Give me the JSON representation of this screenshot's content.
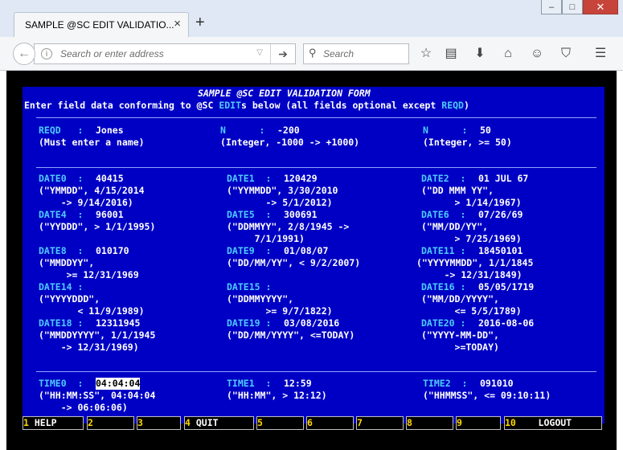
{
  "browser": {
    "tab_title": "SAMPLE @SC EDIT VALIDATIO...",
    "tab_close": "×",
    "new_tab": "+",
    "win_min": "–",
    "win_max": "□",
    "win_close": "✕",
    "url_placeholder": "Search or enter address",
    "search_placeholder": "Search",
    "icons": [
      "back-arrow-icon",
      "info-icon",
      "dropdown-icon",
      "go-arrow-icon",
      "search-icon",
      "bookmark-star-icon",
      "reading-list-icon",
      "download-icon",
      "home-icon",
      "hello-icon",
      "pocket-icon",
      "menu-icon"
    ]
  },
  "form": {
    "title": "SAMPLE @SC EDIT VALIDATION FORM",
    "sub_a": "Enter field data conforming to @SC ",
    "sub_edit": "EDIT",
    "sub_b": "s below (all fields optional except ",
    "sub_reqd": "REQD",
    "sub_c": ")",
    "fields": {
      "reqd": {
        "label": "REQD   : ",
        "value": "Jones",
        "hint": [
          "(Must enter a name)"
        ]
      },
      "n1": {
        "label": "N      : ",
        "value": "-200",
        "hint": [
          "(Integer, -1000 -> +1000)"
        ]
      },
      "n2": {
        "label": "N      : ",
        "value": "50",
        "hint": [
          "(Integer, >= 50)"
        ]
      },
      "date0": {
        "label": "DATE0  : ",
        "value": "40415",
        "hint": [
          "(\"YMMDD\", 4/15/2014",
          "    -> 9/14/2016)"
        ]
      },
      "date1": {
        "label": "DATE1  : ",
        "value": "120429",
        "hint": [
          "(\"YYMMDD\", 3/30/2010",
          "       -> 5/1/2012)"
        ]
      },
      "date2": {
        "label": "DATE2  : ",
        "value": "01 JUL 67",
        "hint": [
          "(\"DD MMM YY\",",
          "      > 1/14/1967)"
        ]
      },
      "date4": {
        "label": "DATE4  : ",
        "value": "96001",
        "hint": [
          "(\"YYDDD\", > 1/1/1995)"
        ]
      },
      "date5": {
        "label": "DATE5  : ",
        "value": "300691",
        "hint": [
          "(\"DDMMYY\", 2/8/1945 ->",
          "     7/1/1991)"
        ]
      },
      "date6": {
        "label": "DATE6  : ",
        "value": "07/26/69",
        "hint": [
          "(\"MM/DD/YY\",",
          "      > 7/25/1969)"
        ]
      },
      "date8": {
        "label": "DATE8  : ",
        "value": "010170",
        "hint": [
          "(\"MMDDYY\",",
          "     >= 12/31/1969"
        ]
      },
      "date9": {
        "label": "DATE9  : ",
        "value": "01/08/07",
        "hint": [
          "(\"DD/MM/YY\", < 9/2/2007)"
        ]
      },
      "date11": {
        "label": "DATE11 : ",
        "value": "18450101",
        "hint": [
          "(\"YYYYMMDD\", 1/1/1845",
          "     -> 12/31/1849)"
        ]
      },
      "date14": {
        "label": "DATE14 : ",
        "value": "",
        "hint": [
          "(\"YYYYDDD\",",
          "       < 11/9/1989)"
        ]
      },
      "date15": {
        "label": "DATE15 : ",
        "value": "",
        "hint": [
          "(\"DDMMYYYY\",",
          "       >= 9/7/1822)"
        ]
      },
      "date16": {
        "label": "DATE16 : ",
        "value": "05/05/1719",
        "hint": [
          "(\"MM/DD/YYYY\",",
          "      <= 5/5/1789)"
        ]
      },
      "date18": {
        "label": "DATE18 : ",
        "value": "12311945",
        "hint": [
          "(\"MMDDYYYY\", 1/1/1945",
          "    -> 12/31/1969)"
        ]
      },
      "date19": {
        "label": "DATE19 : ",
        "value": "03/08/2016",
        "hint": [
          "(\"DD/MM/YYYY\", <=TODAY)"
        ]
      },
      "date20": {
        "label": "DATE20 : ",
        "value": "2016-08-06",
        "hint": [
          "(\"YYYY-MM-DD\",",
          "      >=TODAY)"
        ]
      },
      "time0": {
        "label": "TIME0  : ",
        "value": "04:04:04",
        "hint": [
          "(\"HH:MM:SS\", 04:04:04",
          "    -> 06:06:06)"
        ]
      },
      "time1": {
        "label": "TIME1  : ",
        "value": "12:59",
        "hint": [
          "(\"HH:MM\", > 12:12)"
        ]
      },
      "time2": {
        "label": "TIME2  : ",
        "value": "091010",
        "hint": [
          "(\"HHMMSS\", <= 09:10:11)"
        ]
      }
    }
  },
  "fkeys": [
    {
      "num": "1",
      "label": " HELP"
    },
    {
      "num": "2",
      "label": ""
    },
    {
      "num": "3",
      "label": ""
    },
    {
      "num": "4",
      "label": " QUIT"
    },
    {
      "num": "5",
      "label": ""
    },
    {
      "num": "6",
      "label": ""
    },
    {
      "num": "7",
      "label": ""
    },
    {
      "num": "8",
      "label": ""
    },
    {
      "num": "9",
      "label": ""
    },
    {
      "num": "10",
      "label": "    LOGOUT"
    }
  ]
}
